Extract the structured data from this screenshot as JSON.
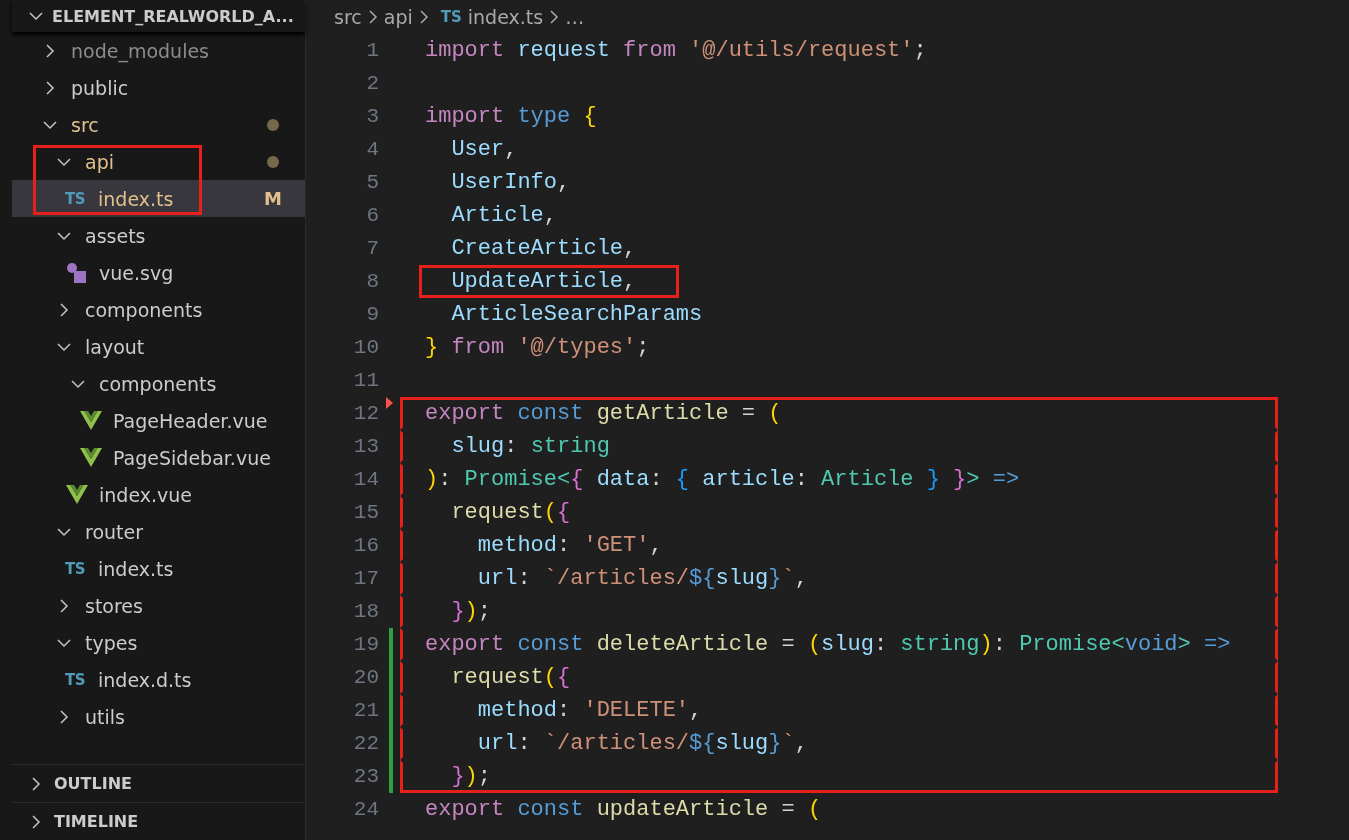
{
  "sidebar": {
    "title": "ELEMENT_REALWORLD_A...",
    "expanded": true,
    "tree": [
      {
        "name": "node_modules",
        "kind": "folder",
        "expanded": false,
        "ignored": true,
        "modified": false,
        "selected": false,
        "marked": false
      },
      {
        "name": "public",
        "kind": "folder",
        "expanded": false,
        "ignored": false,
        "modified": false,
        "selected": false,
        "marked": false
      },
      {
        "name": "src",
        "kind": "folder",
        "expanded": true,
        "ignored": false,
        "modified": true,
        "selected": false,
        "marked": false,
        "children": [
          {
            "name": "api",
            "kind": "folder",
            "expanded": true,
            "ignored": false,
            "modified": true,
            "selected": false,
            "marked": true,
            "children": [
              {
                "name": "index.ts",
                "kind": "ts",
                "icon_text": "TS",
                "ignored": false,
                "modified": true,
                "selected": true,
                "marked": false,
                "status": "M"
              }
            ]
          },
          {
            "name": "assets",
            "kind": "folder",
            "expanded": true,
            "ignored": false,
            "modified": false,
            "selected": false,
            "marked": false,
            "children": [
              {
                "name": "vue.svg",
                "kind": "svg",
                "ignored": false,
                "modified": false,
                "selected": false,
                "marked": false
              }
            ]
          },
          {
            "name": "components",
            "kind": "folder",
            "expanded": false,
            "ignored": false,
            "modified": false,
            "selected": false,
            "marked": false
          },
          {
            "name": "layout",
            "kind": "folder",
            "expanded": true,
            "ignored": false,
            "modified": false,
            "selected": false,
            "marked": false,
            "children": [
              {
                "name": "components",
                "kind": "folder",
                "expanded": true,
                "ignored": false,
                "modified": false,
                "selected": false,
                "marked": false,
                "children": [
                  {
                    "name": "PageHeader.vue",
                    "kind": "vue",
                    "ignored": false,
                    "modified": false,
                    "selected": false,
                    "marked": false
                  },
                  {
                    "name": "PageSidebar.vue",
                    "kind": "vue",
                    "ignored": false,
                    "modified": false,
                    "selected": false,
                    "marked": false
                  }
                ]
              },
              {
                "name": "index.vue",
                "kind": "vue",
                "ignored": false,
                "modified": false,
                "selected": false,
                "marked": false
              }
            ]
          },
          {
            "name": "router",
            "kind": "folder",
            "expanded": true,
            "ignored": false,
            "modified": false,
            "selected": false,
            "marked": false,
            "children": [
              {
                "name": "index.ts",
                "kind": "ts",
                "icon_text": "TS",
                "ignored": false,
                "modified": false,
                "selected": false,
                "marked": false
              }
            ]
          },
          {
            "name": "stores",
            "kind": "folder",
            "expanded": false,
            "ignored": false,
            "modified": false,
            "selected": false,
            "marked": false
          },
          {
            "name": "types",
            "kind": "folder",
            "expanded": true,
            "ignored": false,
            "modified": false,
            "selected": false,
            "marked": false,
            "children": [
              {
                "name": "index.d.ts",
                "kind": "ts",
                "icon_text": "TS",
                "ignored": false,
                "modified": false,
                "selected": false,
                "marked": false
              }
            ]
          },
          {
            "name": "utils",
            "kind": "folder",
            "expanded": false,
            "ignored": false,
            "modified": false,
            "selected": false,
            "marked": false
          }
        ]
      }
    ],
    "sections": [
      {
        "title": "OUTLINE",
        "expanded": false
      },
      {
        "title": "TIMELINE",
        "expanded": false
      }
    ]
  },
  "breadcrumb": [
    {
      "kind": "folder",
      "text": "src"
    },
    {
      "kind": "folder",
      "text": "api"
    },
    {
      "kind": "ts",
      "icon_text": "TS",
      "text": "index.ts"
    },
    {
      "kind": "more",
      "text": "…"
    }
  ],
  "editor": {
    "lines": [
      {
        "number": "1",
        "added": false,
        "deleted": false,
        "marked": false,
        "tokens": [
          {
            "kind": "keyword",
            "text": "import"
          },
          {
            "kind": "variable",
            "text": " request"
          },
          {
            "kind": "keyword",
            "text": " from"
          },
          {
            "kind": "string",
            "text": " '@/utils/request'"
          },
          {
            "kind": "plain",
            "text": ";"
          }
        ]
      },
      {
        "number": "2",
        "added": false,
        "deleted": false
      },
      {
        "number": "3",
        "added": false,
        "deleted": false,
        "marked": false,
        "tokens": [
          {
            "kind": "keyword",
            "text": "import"
          },
          {
            "kind": "storage",
            "text": " type"
          },
          {
            "kind": "bracket1",
            "text": " {"
          }
        ]
      },
      {
        "number": "4",
        "added": false,
        "deleted": false,
        "marked": false,
        "tokens": [
          {
            "kind": "variable",
            "text": "  User"
          },
          {
            "kind": "plain",
            "text": ","
          }
        ]
      },
      {
        "number": "5",
        "added": false,
        "deleted": false,
        "marked": false,
        "tokens": [
          {
            "kind": "variable",
            "text": "  UserInfo"
          },
          {
            "kind": "plain",
            "text": ","
          }
        ]
      },
      {
        "number": "6",
        "added": false,
        "deleted": false,
        "marked": false,
        "tokens": [
          {
            "kind": "variable",
            "text": "  Article"
          },
          {
            "kind": "plain",
            "text": ","
          }
        ]
      },
      {
        "number": "7",
        "added": false,
        "deleted": false,
        "marked": false,
        "tokens": [
          {
            "kind": "variable",
            "text": "  CreateArticle"
          },
          {
            "kind": "plain",
            "text": ","
          }
        ]
      },
      {
        "number": "8",
        "added": false,
        "deleted": false,
        "marked": true,
        "tokens": [
          {
            "kind": "variable",
            "text": "  UpdateArticle"
          },
          {
            "kind": "plain",
            "text": ","
          }
        ]
      },
      {
        "number": "9",
        "added": false,
        "deleted": false,
        "marked": false,
        "tokens": [
          {
            "kind": "variable",
            "text": "  ArticleSearchParams"
          }
        ]
      },
      {
        "number": "10",
        "added": false,
        "deleted": false,
        "marked": false,
        "tokens": [
          {
            "kind": "bracket1",
            "text": "}"
          },
          {
            "kind": "keyword",
            "text": " from"
          },
          {
            "kind": "string",
            "text": " '@/types'"
          },
          {
            "kind": "plain",
            "text": ";"
          }
        ]
      },
      {
        "number": "11",
        "added": false,
        "deleted": false
      },
      {
        "number": "12",
        "added": false,
        "deleted": true,
        "marked": true,
        "tokens": [
          {
            "kind": "keyword",
            "text": "export"
          },
          {
            "kind": "storage",
            "text": " const"
          },
          {
            "kind": "function",
            "text": " getArticle"
          },
          {
            "kind": "plain",
            "text": " = "
          },
          {
            "kind": "bracket1",
            "text": "("
          }
        ]
      },
      {
        "number": "13",
        "added": false,
        "deleted": false,
        "marked": true,
        "tokens": [
          {
            "kind": "variable",
            "text": "  slug"
          },
          {
            "kind": "plain",
            "text": ": "
          },
          {
            "kind": "type",
            "text": "string"
          }
        ]
      },
      {
        "number": "14",
        "added": false,
        "deleted": false,
        "marked": true,
        "tokens": [
          {
            "kind": "bracket1",
            "text": ")"
          },
          {
            "kind": "plain",
            "text": ": "
          },
          {
            "kind": "type",
            "text": "Promise<"
          },
          {
            "kind": "bracket2",
            "text": "{"
          },
          {
            "kind": "variable",
            "text": " data"
          },
          {
            "kind": "plain",
            "text": ": "
          },
          {
            "kind": "bracket3",
            "text": "{"
          },
          {
            "kind": "variable",
            "text": " article"
          },
          {
            "kind": "plain",
            "text": ": "
          },
          {
            "kind": "type",
            "text": "Article"
          },
          {
            "kind": "bracket3",
            "text": " }"
          },
          {
            "kind": "bracket2",
            "text": " }"
          },
          {
            "kind": "type",
            "text": ">"
          },
          {
            "kind": "storage",
            "text": " =>"
          }
        ]
      },
      {
        "number": "15",
        "added": false,
        "deleted": false,
        "marked": true,
        "tokens": [
          {
            "kind": "function",
            "text": "  request"
          },
          {
            "kind": "bracket1",
            "text": "("
          },
          {
            "kind": "bracket2",
            "text": "{"
          }
        ]
      },
      {
        "number": "16",
        "added": false,
        "deleted": false,
        "marked": true,
        "tokens": [
          {
            "kind": "variable",
            "text": "    method"
          },
          {
            "kind": "plain",
            "text": ": "
          },
          {
            "kind": "string",
            "text": "'GET'"
          },
          {
            "kind": "plain",
            "text": ","
          }
        ]
      },
      {
        "number": "17",
        "added": false,
        "deleted": false,
        "marked": true,
        "tokens": [
          {
            "kind": "variable",
            "text": "    url"
          },
          {
            "kind": "plain",
            "text": ": "
          },
          {
            "kind": "string",
            "text": "`/articles/"
          },
          {
            "kind": "storage",
            "text": "${"
          },
          {
            "kind": "variable",
            "text": "slug"
          },
          {
            "kind": "storage",
            "text": "}"
          },
          {
            "kind": "string",
            "text": "`"
          },
          {
            "kind": "plain",
            "text": ","
          }
        ]
      },
      {
        "number": "18",
        "added": false,
        "deleted": false,
        "marked": true,
        "tokens": [
          {
            "kind": "bracket2",
            "text": "  }"
          },
          {
            "kind": "bracket1",
            "text": ")"
          },
          {
            "kind": "plain",
            "text": ";"
          }
        ]
      },
      {
        "number": "19",
        "added": true,
        "deleted": false,
        "marked": true,
        "tokens": [
          {
            "kind": "keyword",
            "text": "export"
          },
          {
            "kind": "storage",
            "text": " const"
          },
          {
            "kind": "function",
            "text": " deleteArticle"
          },
          {
            "kind": "plain",
            "text": " = "
          },
          {
            "kind": "bracket1",
            "text": "("
          },
          {
            "kind": "variable",
            "text": "slug"
          },
          {
            "kind": "plain",
            "text": ": "
          },
          {
            "kind": "type",
            "text": "string"
          },
          {
            "kind": "bracket1",
            "text": ")"
          },
          {
            "kind": "plain",
            "text": ": "
          },
          {
            "kind": "type",
            "text": "Promise<"
          },
          {
            "kind": "storage",
            "text": "void"
          },
          {
            "kind": "type",
            "text": ">"
          },
          {
            "kind": "storage",
            "text": " =>"
          }
        ]
      },
      {
        "number": "20",
        "added": true,
        "deleted": false,
        "marked": true,
        "tokens": [
          {
            "kind": "function",
            "text": "  request"
          },
          {
            "kind": "bracket1",
            "text": "("
          },
          {
            "kind": "bracket2",
            "text": "{"
          }
        ]
      },
      {
        "number": "21",
        "added": true,
        "deleted": false,
        "marked": true,
        "tokens": [
          {
            "kind": "variable",
            "text": "    method"
          },
          {
            "kind": "plain",
            "text": ": "
          },
          {
            "kind": "string",
            "text": "'DELETE'"
          },
          {
            "kind": "plain",
            "text": ","
          }
        ]
      },
      {
        "number": "22",
        "added": true,
        "deleted": false,
        "marked": true,
        "tokens": [
          {
            "kind": "variable",
            "text": "    url"
          },
          {
            "kind": "plain",
            "text": ": "
          },
          {
            "kind": "string",
            "text": "`/articles/"
          },
          {
            "kind": "storage",
            "text": "${"
          },
          {
            "kind": "variable",
            "text": "slug"
          },
          {
            "kind": "storage",
            "text": "}"
          },
          {
            "kind": "string",
            "text": "`"
          },
          {
            "kind": "plain",
            "text": ","
          }
        ]
      },
      {
        "number": "23",
        "added": true,
        "deleted": false,
        "marked": true,
        "tokens": [
          {
            "kind": "bracket2",
            "text": "  }"
          },
          {
            "kind": "bracket1",
            "text": ")"
          },
          {
            "kind": "plain",
            "text": ";"
          }
        ]
      },
      {
        "number": "24",
        "added": false,
        "deleted": false,
        "marked": false,
        "tokens": [
          {
            "kind": "keyword",
            "text": "export"
          },
          {
            "kind": "storage",
            "text": " const"
          },
          {
            "kind": "function",
            "text": " updateArticle"
          },
          {
            "kind": "plain",
            "text": " = "
          },
          {
            "kind": "bracket1",
            "text": "("
          }
        ]
      }
    ]
  }
}
